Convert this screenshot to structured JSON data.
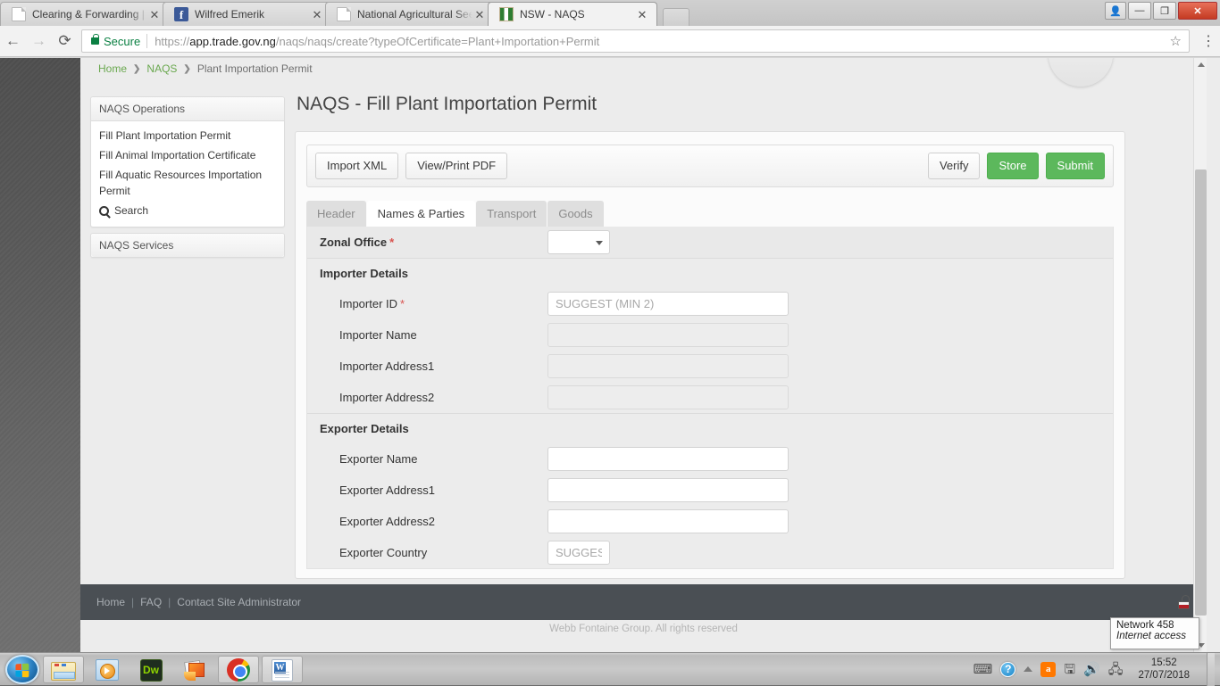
{
  "browser": {
    "tabs": [
      {
        "title": "Clearing & Forwarding | T",
        "favicon": "page-icon",
        "active": false
      },
      {
        "title": "Wilfred Emerik",
        "favicon": "facebook-icon",
        "active": false
      },
      {
        "title": "National Agricultural See",
        "favicon": "page-icon",
        "active": false
      },
      {
        "title": "NSW - NAQS",
        "favicon": "naqs-coat-of-arms-icon",
        "active": true
      }
    ],
    "close_glyph": "✕",
    "nav": {
      "back": "←",
      "forward": "→",
      "reload": "⟳"
    },
    "omnibox": {
      "security_label": "Secure",
      "url_prefix": "https://",
      "url_host": "app.trade.gov.ng",
      "url_path": "/naqs/naqs/create?typeOfCertificate=Plant+Importation+Permit",
      "star_glyph": "☆",
      "menu_glyph": "⋮"
    },
    "window_controls": {
      "user": "👤",
      "minimize": "—",
      "restore": "❐",
      "close": "✕"
    }
  },
  "page": {
    "breadcrumb": {
      "home": "Home",
      "section": "NAQS",
      "current": "Plant Importation Permit",
      "separator": "❯"
    },
    "title": "NAQS - Fill Plant Importation Permit",
    "sidebar": {
      "operations_header": "NAQS Operations",
      "operations_items": [
        {
          "label": "Fill Plant Importation Permit",
          "icon": ""
        },
        {
          "label": "Fill Animal Importation Certificate",
          "icon": ""
        },
        {
          "label": "Fill Aquatic Resources Importation Permit",
          "icon": ""
        },
        {
          "label": "Search",
          "icon": "search-icon"
        }
      ],
      "services_header": "NAQS Services"
    },
    "toolbar": {
      "import_xml": "Import XML",
      "view_print_pdf": "View/Print PDF",
      "verify": "Verify",
      "store": "Store",
      "submit": "Submit"
    },
    "tabs": [
      {
        "label": "Header",
        "active": false
      },
      {
        "label": "Names & Parties",
        "active": true
      },
      {
        "label": "Transport",
        "active": false
      },
      {
        "label": "Goods",
        "active": false
      }
    ],
    "form": {
      "zonal_office": {
        "label": "Zonal Office",
        "required": "*",
        "value": "",
        "control": "dropdown"
      },
      "importer_section": "Importer Details",
      "importer_fields": [
        {
          "label": "Importer ID",
          "required": "*",
          "value": "",
          "placeholder": "SUGGEST (MIN 2)",
          "readonly": false,
          "width": "wide"
        },
        {
          "label": "Importer Name",
          "required": "",
          "value": "",
          "placeholder": "",
          "readonly": true,
          "width": "wide"
        },
        {
          "label": "Importer Address1",
          "required": "",
          "value": "",
          "placeholder": "",
          "readonly": true,
          "width": "wide"
        },
        {
          "label": "Importer Address2",
          "required": "",
          "value": "",
          "placeholder": "",
          "readonly": true,
          "width": "wide"
        }
      ],
      "exporter_section": "Exporter Details",
      "exporter_fields": [
        {
          "label": "Exporter Name",
          "required": "",
          "value": "",
          "placeholder": "",
          "readonly": false,
          "width": "wide"
        },
        {
          "label": "Exporter Address1",
          "required": "",
          "value": "",
          "placeholder": "",
          "readonly": false,
          "width": "wide"
        },
        {
          "label": "Exporter Address2",
          "required": "",
          "value": "",
          "placeholder": "",
          "readonly": false,
          "width": "wide"
        },
        {
          "label": "Exporter Country",
          "required": "",
          "value": "",
          "placeholder": "SUGGEST",
          "readonly": false,
          "width": "narrow"
        }
      ]
    },
    "footer": {
      "home": "Home",
      "faq": "FAQ",
      "contact": "Contact Site Administrator",
      "separator": "|",
      "lock_icon": "padlock-icon",
      "copyright": "Webb Fontaine Group. All rights reserved"
    }
  },
  "tooltip": {
    "line1": "Network  458",
    "line2": "Internet access"
  },
  "taskbar": {
    "start": "start-orb-icon",
    "buttons": [
      {
        "name": "windows-explorer-icon",
        "label": ""
      },
      {
        "name": "windows-media-player-icon",
        "label": ""
      },
      {
        "name": "dreamweaver-icon",
        "label": "Dw"
      },
      {
        "name": "photo-viewer-icon",
        "label": ""
      },
      {
        "name": "google-chrome-icon",
        "label": ""
      },
      {
        "name": "microsoft-word-icon",
        "label": "W"
      }
    ],
    "tray": [
      {
        "name": "keyboard-icon",
        "glyph": "⌨"
      },
      {
        "name": "help-icon",
        "glyph": "?"
      },
      {
        "name": "show-hidden-icons-icon",
        "glyph": "▲"
      },
      {
        "name": "avast-icon",
        "glyph": "a"
      },
      {
        "name": "removable-media-icon",
        "glyph": "🖫"
      },
      {
        "name": "volume-icon",
        "glyph": "🔊"
      },
      {
        "name": "network-icon",
        "glyph": "🖧"
      }
    ],
    "clock": {
      "time": "15:52",
      "date": "27/07/2018"
    }
  },
  "colors": {
    "accent_green": "#5cb85c",
    "link_green": "#6aa84f",
    "required_red": "#d9534f",
    "footer_dark": "#4a4f54",
    "secure_green": "#0b8043"
  }
}
